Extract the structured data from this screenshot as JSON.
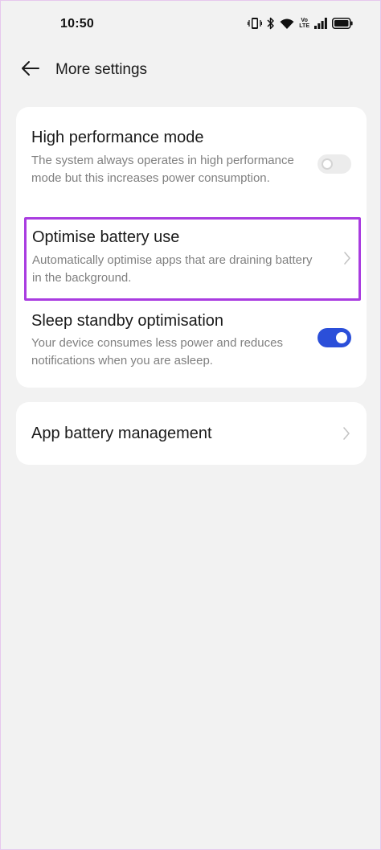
{
  "status_bar": {
    "time": "10:50",
    "volte_top": "Vo",
    "volte_bottom": "LTE"
  },
  "header": {
    "title": "More settings"
  },
  "settings": {
    "high_performance": {
      "title": "High performance mode",
      "description": "The system always operates in high performance mode but this increases power consumption.",
      "enabled": false
    },
    "optimise_battery": {
      "title": "Optimise battery use",
      "description": "Automatically optimise apps that are draining battery in the background."
    },
    "sleep_standby": {
      "title": "Sleep standby optimisation",
      "description": "Your device consumes less power and reduces notifications when you are asleep.",
      "enabled": true
    },
    "app_battery": {
      "title": "App battery management"
    }
  },
  "colors": {
    "accent": "#2b4fd9",
    "highlight_border": "#a93ce0",
    "background": "#f2f2f2",
    "card": "#ffffff",
    "secondary_text": "#808080"
  },
  "icons": {
    "back": "arrow-left-icon",
    "chevron": "chevron-right-icon",
    "status": [
      "vibrate-icon",
      "bluetooth-icon",
      "wifi-icon",
      "volte-icon",
      "signal-icon",
      "battery-icon"
    ]
  }
}
